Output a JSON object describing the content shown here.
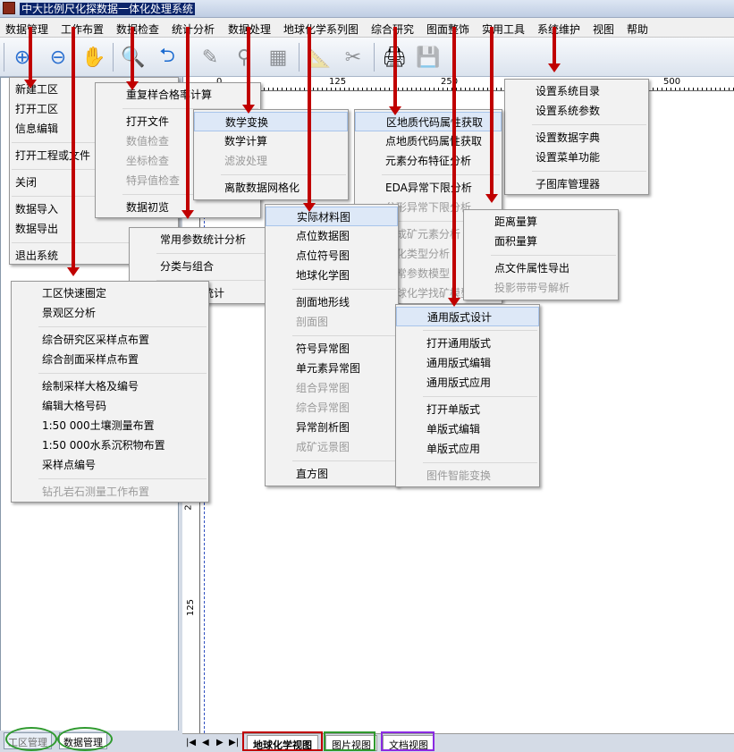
{
  "app": {
    "title": "中大比例尺化探数据一体化处理系统"
  },
  "menubar": [
    "数据管理",
    "工作布置",
    "数据检查",
    "统计分析",
    "数据处理",
    "地球化学系列图",
    "综合研究",
    "图面整饰",
    "实用工具",
    "系统维护",
    "视图",
    "帮助"
  ],
  "ruler": {
    "top": [
      "0",
      "125",
      "250",
      "500"
    ],
    "left": [
      "2",
      "125"
    ]
  },
  "menus": {
    "data_mgmt": [
      {
        "t": "新建工区"
      },
      {
        "t": "打开工区"
      },
      {
        "t": "信息编辑"
      },
      {
        "t": "打开工程或文件"
      },
      {
        "t": "关闭"
      },
      {
        "t": "数据导入"
      },
      {
        "t": "数据导出"
      },
      {
        "t": "退出系统"
      }
    ],
    "work_layout": [
      {
        "t": "工区快速圈定"
      },
      {
        "t": "景观区分析"
      },
      {
        "t": "综合研究区采样点布置"
      },
      {
        "t": "综合剖面采样点布置"
      },
      {
        "t": "绘制采样大格及编号"
      },
      {
        "t": "编辑大格号码"
      },
      {
        "t": "1:50 000土壤测量布置"
      },
      {
        "t": "1:50 000水系沉积物布置"
      },
      {
        "t": "采样点编号"
      },
      {
        "t": "钻孔岩石测量工作布置",
        "d": true
      }
    ],
    "data_check": [
      {
        "t": "重复样合格率计算"
      },
      {
        "t": "打开文件"
      },
      {
        "t": "数值检查",
        "d": true
      },
      {
        "t": "坐标检查",
        "d": true
      },
      {
        "t": "特异值检查",
        "d": true
      },
      {
        "t": "数据初览"
      }
    ],
    "stats": [
      {
        "t": "常用参数统计分析"
      },
      {
        "t": "分类与组合"
      },
      {
        "t": "异常参数统计"
      }
    ],
    "data_proc": [
      {
        "t": "数学变换"
      },
      {
        "t": "数学计算"
      },
      {
        "t": "滤波处理",
        "d": true
      },
      {
        "t": "离散数据网格化"
      }
    ],
    "geochem": [
      {
        "t": "实际材料图"
      },
      {
        "t": "点位数据图"
      },
      {
        "t": "点位符号图"
      },
      {
        "t": "地球化学图"
      },
      {
        "t": "剖面地形线"
      },
      {
        "t": "剖面图",
        "d": true
      },
      {
        "t": "符号异常图"
      },
      {
        "t": "单元素异常图"
      },
      {
        "t": "组合异常图",
        "d": true
      },
      {
        "t": "综合异常图",
        "d": true
      },
      {
        "t": "异常剖析图"
      },
      {
        "t": "成矿远景图",
        "d": true
      },
      {
        "t": "直方图"
      }
    ],
    "research": [
      {
        "t": "区地质代码属性获取"
      },
      {
        "t": "点地质代码属性获取"
      },
      {
        "t": "元素分布特征分析"
      },
      {
        "t": "EDA异常下限分析"
      },
      {
        "t": "分形异常下限分析",
        "d": true
      },
      {
        "t": "主成矿元素分析",
        "d": true
      },
      {
        "t": "矿化类型分析",
        "d": true
      },
      {
        "t": "异常参数模型",
        "d": true
      },
      {
        "t": "地球化学找矿模型",
        "d": true
      }
    ],
    "decor": [
      {
        "t": "通用版式设计"
      },
      {
        "t": "打开通用版式"
      },
      {
        "t": "通用版式编辑"
      },
      {
        "t": "通用版式应用"
      },
      {
        "t": "打开单版式"
      },
      {
        "t": "单版式编辑"
      },
      {
        "t": "单版式应用"
      },
      {
        "t": "图件智能变换",
        "d": true
      }
    ],
    "tools": [
      {
        "t": "距离量算"
      },
      {
        "t": "面积量算"
      },
      {
        "t": "点文件属性导出"
      },
      {
        "t": "投影带带号解析",
        "d": true
      }
    ],
    "sysmaint": [
      {
        "t": "设置系统目录"
      },
      {
        "t": "设置系统参数"
      },
      {
        "t": "设置数据字典"
      },
      {
        "t": "设置菜单功能"
      },
      {
        "t": "子图库管理器"
      }
    ]
  },
  "left_tabs": [
    "工区管理",
    "数据管理"
  ],
  "bottom_nav": [
    "|◀",
    "◀",
    "▶",
    "▶|"
  ],
  "bottom_tabs": [
    "地球化学视图",
    "图片视图",
    "文档视图"
  ],
  "colors": {
    "arrow": "#c00000",
    "green": "#2f9a2f",
    "red_box": "#c00000",
    "green_box": "#2f9a2f",
    "purple_box": "#8a2be2"
  }
}
